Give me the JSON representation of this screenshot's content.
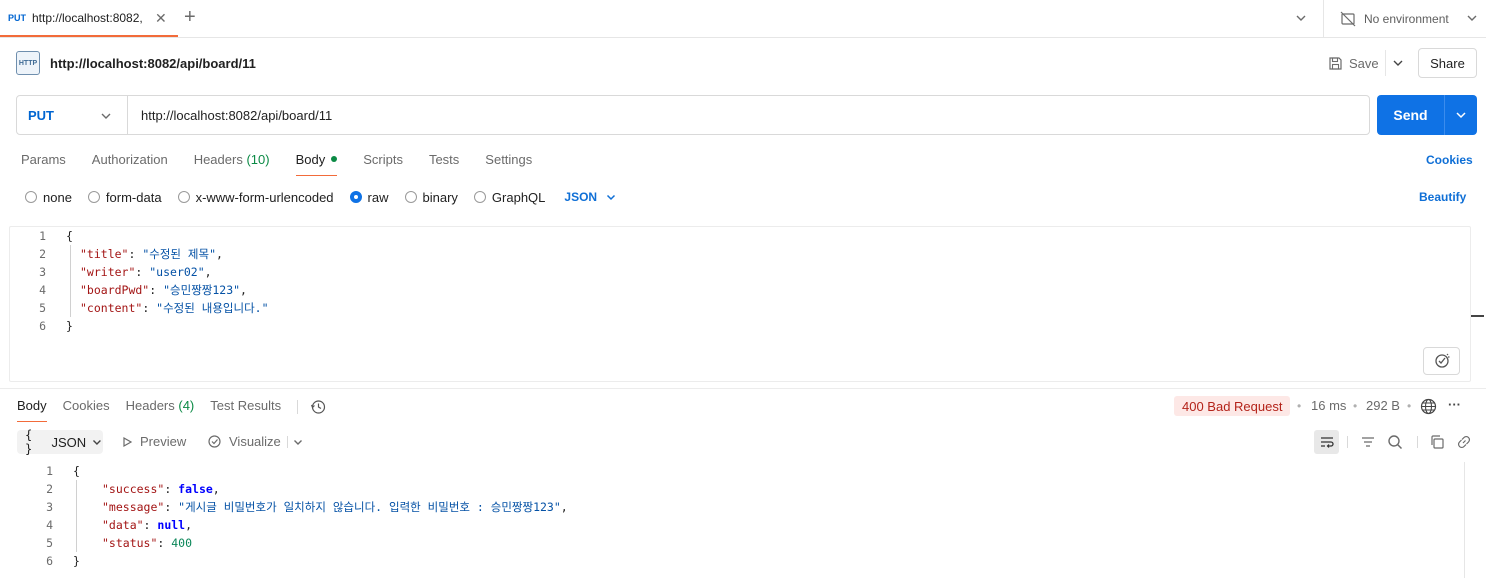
{
  "tab": {
    "method": "PUT",
    "title": "http://localhost:8082,"
  },
  "environment": {
    "label": "No environment"
  },
  "request": {
    "icon_text": "HTTP",
    "name": "http://localhost:8082/api/board/11",
    "save_label": "Save",
    "share_label": "Share",
    "method": "PUT",
    "url": "http://localhost:8082/api/board/11",
    "send_label": "Send"
  },
  "request_tabs": [
    {
      "label": "Params",
      "count": ""
    },
    {
      "label": "Authorization",
      "count": ""
    },
    {
      "label": "Headers",
      "count": "(10)"
    },
    {
      "label": "Body",
      "count": ""
    },
    {
      "label": "Scripts",
      "count": ""
    },
    {
      "label": "Tests",
      "count": ""
    },
    {
      "label": "Settings",
      "count": ""
    }
  ],
  "cookies_label": "Cookies",
  "body_options": {
    "none": "none",
    "form_data": "form-data",
    "urlencoded": "x-www-form-urlencoded",
    "raw": "raw",
    "binary": "binary",
    "graphql": "GraphQL",
    "format": "JSON",
    "selected": "raw"
  },
  "beautify_label": "Beautify",
  "request_body": {
    "line_numbers": [
      "1",
      "2",
      "3",
      "4",
      "5",
      "6"
    ],
    "open": "{",
    "close": "}",
    "fields": [
      {
        "key": "\"title\"",
        "value": "\"수정된 제목\""
      },
      {
        "key": "\"writer\"",
        "value": "\"user02\""
      },
      {
        "key": "\"boardPwd\"",
        "value": "\"승민짱짱123\""
      },
      {
        "key": "\"content\"",
        "value": "\"수정된 내용입니다.\""
      }
    ]
  },
  "response_tabs": [
    {
      "label": "Body",
      "count": ""
    },
    {
      "label": "Cookies",
      "count": ""
    },
    {
      "label": "Headers",
      "count": "(4)"
    },
    {
      "label": "Test Results",
      "count": ""
    }
  ],
  "response_meta": {
    "status": "400 Bad Request",
    "status_color": "#b4231a",
    "time": "16 ms",
    "size": "292 B"
  },
  "response_toolbar": {
    "format": "JSON",
    "preview": "Preview",
    "visualize": "Visualize"
  },
  "response_body": {
    "line_numbers": [
      "1",
      "2",
      "3",
      "4",
      "5",
      "6"
    ],
    "open": "{",
    "close": "}",
    "success_key": "\"success\"",
    "success_value": "false",
    "message_key": "\"message\"",
    "message_value": "\"게시글 비밀번호가 일치하지 않습니다. 입력한 비밀번호 : 승민짱짱123\"",
    "data_key": "\"data\"",
    "data_value": "null",
    "status_key": "\"status\"",
    "status_value": "400"
  },
  "colors": {
    "accent": "#0f72e5",
    "active_tab_underline": "#f26b3a",
    "json_key": "#a31515",
    "json_string": "#0451a5",
    "json_number": "#098658"
  }
}
